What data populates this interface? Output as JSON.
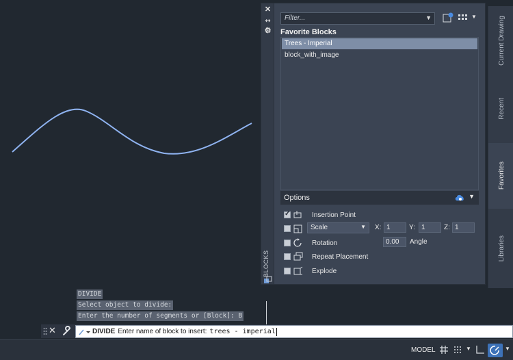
{
  "palette": {
    "title": "BLOCKS",
    "filter_placeholder": "Filter...",
    "section_title": "Favorite Blocks",
    "blocks": [
      {
        "name": "Trees - Imperial",
        "selected": true
      },
      {
        "name": "block_with_image",
        "selected": false
      }
    ],
    "side_tabs": [
      "Current Drawing",
      "Recent",
      "Favorites",
      "Libraries"
    ],
    "active_tab": "Favorites",
    "options": {
      "title": "Options",
      "insertion_point": {
        "label": "Insertion Point",
        "checked": true
      },
      "scale": {
        "mode": "Scale",
        "x_label": "X:",
        "x": "1",
        "y_label": "Y:",
        "y": "1",
        "z_label": "Z:",
        "z": "1",
        "checked": false
      },
      "rotation": {
        "label": "Rotation",
        "angle": "0.00",
        "angle_label": "Angle",
        "checked": false
      },
      "repeat": {
        "label": "Repeat Placement",
        "checked": false
      },
      "explode": {
        "label": "Explode",
        "checked": false
      }
    }
  },
  "history": {
    "lines": [
      "DIVIDE",
      "Select object to divide:",
      "Enter the number of segments or [Block]: B"
    ]
  },
  "command_line": {
    "command": "DIVIDE",
    "prompt": "Enter name of block to insert:",
    "value": "trees - imperial"
  },
  "status_bar": {
    "model_label": "MODEL"
  },
  "colors": {
    "canvas": "#212830",
    "curve": "#8fb3f0",
    "palette_bg": "#3b4453",
    "selection": "#7e8ea7",
    "accent": "#3d72b8"
  }
}
